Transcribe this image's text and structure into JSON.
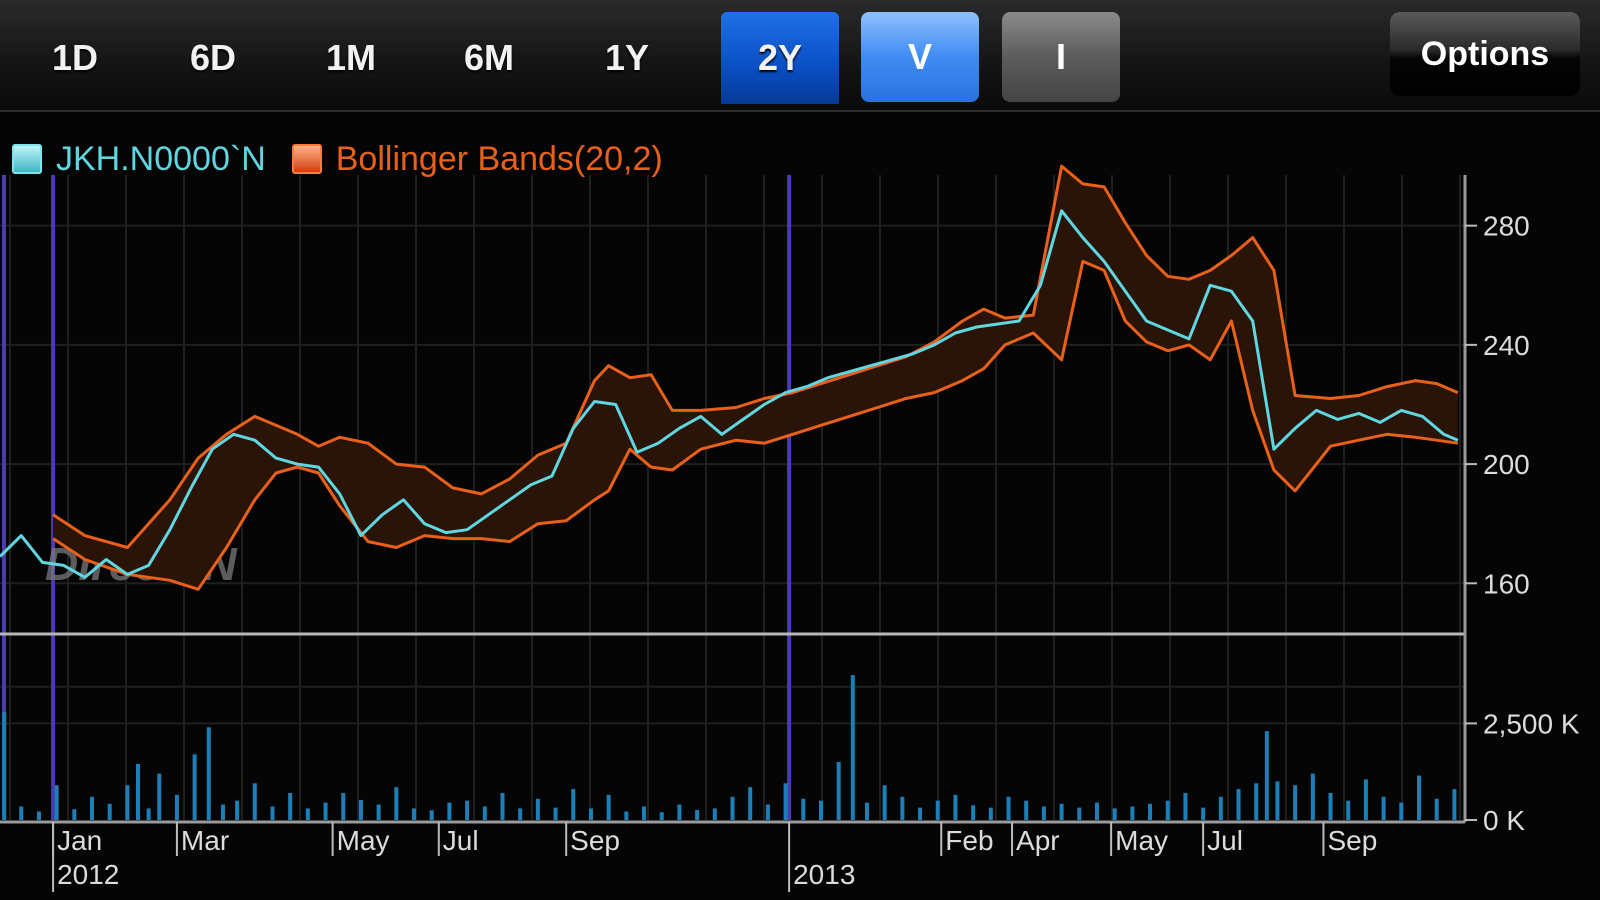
{
  "toolbar": {
    "tabs": [
      {
        "label": "1D",
        "active": false
      },
      {
        "label": "6D",
        "active": false
      },
      {
        "label": "1M",
        "active": false
      },
      {
        "label": "6M",
        "active": false
      },
      {
        "label": "1Y",
        "active": false
      },
      {
        "label": "2Y",
        "active": true
      }
    ],
    "volume_toggle": "V",
    "indicator_toggle": "I",
    "options_label": "Options"
  },
  "legend": {
    "series_label": "JKH.N0000`N",
    "bands_label": "Bollinger Bands(20,2)"
  },
  "watermark": "DirectFN",
  "colors": {
    "price": "#5fd6e0",
    "bands": "#e8601a",
    "band_fill": "#2a1408",
    "volume": "#1d7fb8",
    "grid": "#1f1f1f",
    "year_marker": "#4b3bb0",
    "active_tab": "#0a5bd6"
  },
  "chart_data": {
    "type": "line",
    "price_axis": {
      "ticks": [
        "160",
        "200",
        "240",
        "280"
      ],
      "ylim": [
        145,
        297
      ]
    },
    "volume_axis": {
      "ticks": [
        "0 K",
        "2,500 K"
      ],
      "ylim": [
        0,
        4400
      ]
    },
    "x_ticks": [
      {
        "label": "Jan",
        "x": 0.75
      },
      {
        "label": "Mar",
        "x": 2.5
      },
      {
        "label": "May",
        "x": 4.7
      },
      {
        "label": "Jul",
        "x": 6.2
      },
      {
        "label": "Sep",
        "x": 8.0
      },
      {
        "label": "Feb",
        "x": 13.3
      },
      {
        "label": "Apr",
        "x": 14.3
      },
      {
        "label": "May",
        "x": 15.7
      },
      {
        "label": "Jul",
        "x": 17.0
      },
      {
        "label": "Sep",
        "x": 18.7
      }
    ],
    "year_labels": [
      {
        "label": "2012",
        "x": 0.75
      },
      {
        "label": "2013",
        "x": 11.15
      }
    ],
    "xlim": [
      0,
      20.7
    ],
    "series": [
      {
        "name": "JKH.N0000`N",
        "values": [
          [
            0.0,
            169
          ],
          [
            0.3,
            176
          ],
          [
            0.6,
            167
          ],
          [
            0.9,
            166
          ],
          [
            1.2,
            162
          ],
          [
            1.5,
            168
          ],
          [
            1.8,
            163
          ],
          [
            2.1,
            166
          ],
          [
            2.4,
            178
          ],
          [
            2.7,
            192
          ],
          [
            3.0,
            205
          ],
          [
            3.3,
            210
          ],
          [
            3.6,
            208
          ],
          [
            3.9,
            202
          ],
          [
            4.2,
            200
          ],
          [
            4.5,
            199
          ],
          [
            4.8,
            190
          ],
          [
            5.1,
            176
          ],
          [
            5.4,
            183
          ],
          [
            5.7,
            188
          ],
          [
            6.0,
            180
          ],
          [
            6.3,
            177
          ],
          [
            6.6,
            178
          ],
          [
            6.9,
            183
          ],
          [
            7.2,
            188
          ],
          [
            7.5,
            193
          ],
          [
            7.8,
            196
          ],
          [
            8.1,
            212
          ],
          [
            8.4,
            221
          ],
          [
            8.7,
            220
          ],
          [
            9.0,
            204
          ],
          [
            9.3,
            207
          ],
          [
            9.6,
            212
          ],
          [
            9.9,
            216
          ],
          [
            10.2,
            210
          ],
          [
            10.5,
            215
          ],
          [
            10.8,
            220
          ],
          [
            11.1,
            224
          ],
          [
            11.4,
            226
          ],
          [
            11.7,
            229
          ],
          [
            12.0,
            231
          ],
          [
            12.3,
            233
          ],
          [
            12.6,
            235
          ],
          [
            12.9,
            237
          ],
          [
            13.2,
            240
          ],
          [
            13.5,
            244
          ],
          [
            13.8,
            246
          ],
          [
            14.1,
            247
          ],
          [
            14.4,
            248
          ],
          [
            14.7,
            260
          ],
          [
            15.0,
            285
          ],
          [
            15.3,
            276
          ],
          [
            15.6,
            268
          ],
          [
            15.9,
            258
          ],
          [
            16.2,
            248
          ],
          [
            16.5,
            245
          ],
          [
            16.8,
            242
          ],
          [
            17.1,
            260
          ],
          [
            17.4,
            258
          ],
          [
            17.7,
            248
          ],
          [
            18.0,
            205
          ],
          [
            18.3,
            212
          ],
          [
            18.6,
            218
          ],
          [
            18.9,
            215
          ],
          [
            19.2,
            217
          ],
          [
            19.5,
            214
          ],
          [
            19.8,
            218
          ],
          [
            20.1,
            216
          ],
          [
            20.4,
            210
          ],
          [
            20.6,
            208
          ]
        ]
      },
      {
        "name": "upper",
        "values": [
          [
            0.75,
            183
          ],
          [
            1.2,
            176
          ],
          [
            1.8,
            172
          ],
          [
            2.4,
            188
          ],
          [
            2.8,
            202
          ],
          [
            3.2,
            210
          ],
          [
            3.6,
            216
          ],
          [
            3.9,
            213
          ],
          [
            4.2,
            210
          ],
          [
            4.5,
            206
          ],
          [
            4.8,
            209
          ],
          [
            5.2,
            207
          ],
          [
            5.6,
            200
          ],
          [
            6.0,
            199
          ],
          [
            6.4,
            192
          ],
          [
            6.8,
            190
          ],
          [
            7.2,
            195
          ],
          [
            7.6,
            203
          ],
          [
            8.0,
            207
          ],
          [
            8.4,
            228
          ],
          [
            8.6,
            233
          ],
          [
            8.9,
            229
          ],
          [
            9.2,
            230
          ],
          [
            9.5,
            218
          ],
          [
            9.9,
            218
          ],
          [
            10.4,
            219
          ],
          [
            10.8,
            222
          ],
          [
            11.2,
            224
          ],
          [
            11.6,
            227
          ],
          [
            12.0,
            230
          ],
          [
            12.4,
            233
          ],
          [
            12.8,
            236
          ],
          [
            13.2,
            241
          ],
          [
            13.6,
            248
          ],
          [
            13.9,
            252
          ],
          [
            14.2,
            249
          ],
          [
            14.6,
            250
          ],
          [
            15.0,
            300
          ],
          [
            15.3,
            294
          ],
          [
            15.6,
            293
          ],
          [
            15.9,
            281
          ],
          [
            16.2,
            270
          ],
          [
            16.5,
            263
          ],
          [
            16.8,
            262
          ],
          [
            17.1,
            265
          ],
          [
            17.4,
            270
          ],
          [
            17.7,
            276
          ],
          [
            18.0,
            265
          ],
          [
            18.3,
            223
          ],
          [
            18.8,
            222
          ],
          [
            19.2,
            223
          ],
          [
            19.6,
            226
          ],
          [
            20.0,
            228
          ],
          [
            20.3,
            227
          ],
          [
            20.6,
            224
          ]
        ]
      },
      {
        "name": "lower",
        "values": [
          [
            0.75,
            175
          ],
          [
            1.2,
            168
          ],
          [
            1.8,
            163
          ],
          [
            2.4,
            161
          ],
          [
            2.8,
            158
          ],
          [
            3.2,
            172
          ],
          [
            3.6,
            188
          ],
          [
            3.9,
            197
          ],
          [
            4.2,
            199
          ],
          [
            4.5,
            197
          ],
          [
            4.8,
            186
          ],
          [
            5.2,
            174
          ],
          [
            5.6,
            172
          ],
          [
            6.0,
            176
          ],
          [
            6.4,
            175
          ],
          [
            6.8,
            175
          ],
          [
            7.2,
            174
          ],
          [
            7.6,
            180
          ],
          [
            8.0,
            181
          ],
          [
            8.4,
            188
          ],
          [
            8.6,
            191
          ],
          [
            8.9,
            205
          ],
          [
            9.2,
            199
          ],
          [
            9.5,
            198
          ],
          [
            9.9,
            205
          ],
          [
            10.4,
            208
          ],
          [
            10.8,
            207
          ],
          [
            11.2,
            210
          ],
          [
            11.6,
            213
          ],
          [
            12.0,
            216
          ],
          [
            12.4,
            219
          ],
          [
            12.8,
            222
          ],
          [
            13.2,
            224
          ],
          [
            13.6,
            228
          ],
          [
            13.9,
            232
          ],
          [
            14.2,
            240
          ],
          [
            14.6,
            244
          ],
          [
            15.0,
            235
          ],
          [
            15.3,
            268
          ],
          [
            15.6,
            265
          ],
          [
            15.9,
            248
          ],
          [
            16.2,
            241
          ],
          [
            16.5,
            238
          ],
          [
            16.8,
            240
          ],
          [
            17.1,
            235
          ],
          [
            17.4,
            248
          ],
          [
            17.7,
            218
          ],
          [
            18.0,
            198
          ],
          [
            18.3,
            191
          ],
          [
            18.8,
            206
          ],
          [
            19.2,
            208
          ],
          [
            19.6,
            210
          ],
          [
            20.0,
            209
          ],
          [
            20.3,
            208
          ],
          [
            20.6,
            207
          ]
        ]
      }
    ],
    "volume_series": {
      "name": "Volume",
      "values": [
        [
          0.06,
          2800
        ],
        [
          0.3,
          350
        ],
        [
          0.55,
          220
        ],
        [
          0.8,
          900
        ],
        [
          1.05,
          280
        ],
        [
          1.3,
          600
        ],
        [
          1.55,
          420
        ],
        [
          1.8,
          900
        ],
        [
          1.95,
          1450
        ],
        [
          2.1,
          300
        ],
        [
          2.25,
          1200
        ],
        [
          2.5,
          650
        ],
        [
          2.75,
          1700
        ],
        [
          2.95,
          2400
        ],
        [
          3.15,
          400
        ],
        [
          3.35,
          500
        ],
        [
          3.6,
          950
        ],
        [
          3.85,
          350
        ],
        [
          4.1,
          700
        ],
        [
          4.35,
          300
        ],
        [
          4.6,
          450
        ],
        [
          4.85,
          700
        ],
        [
          5.1,
          520
        ],
        [
          5.35,
          400
        ],
        [
          5.6,
          850
        ],
        [
          5.85,
          300
        ],
        [
          6.1,
          250
        ],
        [
          6.35,
          450
        ],
        [
          6.6,
          500
        ],
        [
          6.85,
          350
        ],
        [
          7.1,
          700
        ],
        [
          7.35,
          300
        ],
        [
          7.6,
          550
        ],
        [
          7.85,
          320
        ],
        [
          8.1,
          800
        ],
        [
          8.35,
          300
        ],
        [
          8.6,
          650
        ],
        [
          8.85,
          220
        ],
        [
          9.1,
          350
        ],
        [
          9.35,
          200
        ],
        [
          9.6,
          400
        ],
        [
          9.85,
          260
        ],
        [
          10.1,
          300
        ],
        [
          10.35,
          600
        ],
        [
          10.6,
          850
        ],
        [
          10.85,
          400
        ],
        [
          11.1,
          950
        ],
        [
          11.35,
          550
        ],
        [
          11.6,
          500
        ],
        [
          11.85,
          1500
        ],
        [
          12.05,
          3750
        ],
        [
          12.25,
          450
        ],
        [
          12.5,
          900
        ],
        [
          12.75,
          600
        ],
        [
          13.0,
          320
        ],
        [
          13.25,
          500
        ],
        [
          13.5,
          650
        ],
        [
          13.75,
          380
        ],
        [
          14.0,
          320
        ],
        [
          14.25,
          600
        ],
        [
          14.5,
          500
        ],
        [
          14.75,
          350
        ],
        [
          15.0,
          420
        ],
        [
          15.25,
          320
        ],
        [
          15.5,
          450
        ],
        [
          15.75,
          300
        ],
        [
          16.0,
          350
        ],
        [
          16.25,
          420
        ],
        [
          16.5,
          500
        ],
        [
          16.75,
          700
        ],
        [
          17.0,
          320
        ],
        [
          17.25,
          600
        ],
        [
          17.5,
          800
        ],
        [
          17.75,
          950
        ],
        [
          17.9,
          2300
        ],
        [
          18.05,
          1000
        ],
        [
          18.3,
          900
        ],
        [
          18.55,
          1200
        ],
        [
          18.8,
          700
        ],
        [
          19.05,
          500
        ],
        [
          19.3,
          1050
        ],
        [
          19.55,
          600
        ],
        [
          19.8,
          450
        ],
        [
          20.05,
          1150
        ],
        [
          20.3,
          550
        ],
        [
          20.55,
          800
        ]
      ]
    }
  }
}
